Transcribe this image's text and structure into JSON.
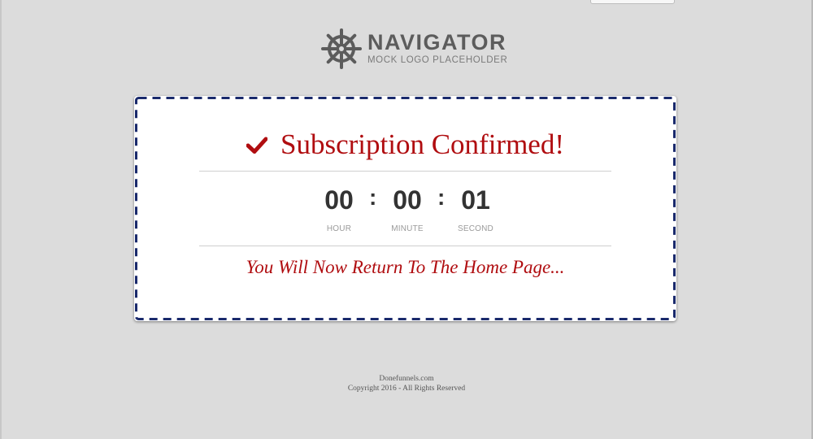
{
  "logo": {
    "icon": "ship-wheel-icon",
    "name": "NAVIGATOR",
    "tagline": "MOCK LOGO PLACEHOLDER"
  },
  "confirmation": {
    "icon": "checkmark-icon",
    "title": "Subscription Confirmed!",
    "countdown": {
      "hour": {
        "value": "00",
        "label": "HOUR"
      },
      "minute": {
        "value": "00",
        "label": "MINUTE"
      },
      "second": {
        "value": "01",
        "label": "SECOND"
      },
      "separator": ":"
    },
    "message": "You Will Now Return To The Home Page..."
  },
  "footer": {
    "site": "Donefunnels.com",
    "copyright": "Copyright 2016 - All Rights Reserved"
  },
  "colors": {
    "background": "#dcdcdc",
    "accent_red": "#b00d10",
    "dash_border": "#1a2a6c",
    "logo_gray": "#5c5c5c"
  }
}
